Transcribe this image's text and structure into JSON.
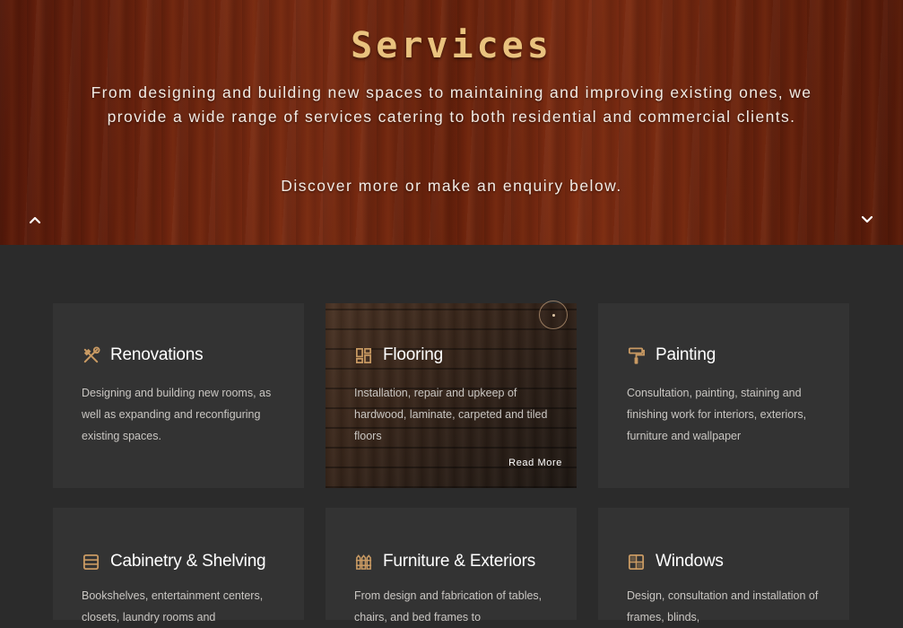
{
  "hero": {
    "title": "Services",
    "description": "From designing and building new spaces to maintaining and improving existing ones, we provide a wide range of services catering to both residential and commercial clients.",
    "subtitle": "Discover more or make an enquiry below."
  },
  "accent_color": "#c99a63",
  "services": [
    {
      "title": "Renovations",
      "icon": "hammer-wrench-icon",
      "description": "Designing and building new rooms, as well as expanding and reconfiguring existing spaces."
    },
    {
      "title": "Flooring",
      "icon": "grid-layout-icon",
      "description": "Installation, repair and upkeep of hardwood, laminate, carpeted and tiled floors",
      "read_more": "Read More"
    },
    {
      "title": "Painting",
      "icon": "paint-roller-icon",
      "description": "Consultation, painting, staining and finishing work for interiors, exteriors, furniture and wallpaper"
    },
    {
      "title": "Cabinetry & Shelving",
      "icon": "shelves-icon",
      "description": "Bookshelves, entertainment centers, closets, laundry rooms and"
    },
    {
      "title": "Furniture & Exteriors",
      "icon": "fence-icon",
      "description": "From design and fabrication of tables, chairs, and bed frames to"
    },
    {
      "title": "Windows",
      "icon": "window-icon",
      "description": "Design, consultation and installation of frames, blinds,"
    }
  ]
}
